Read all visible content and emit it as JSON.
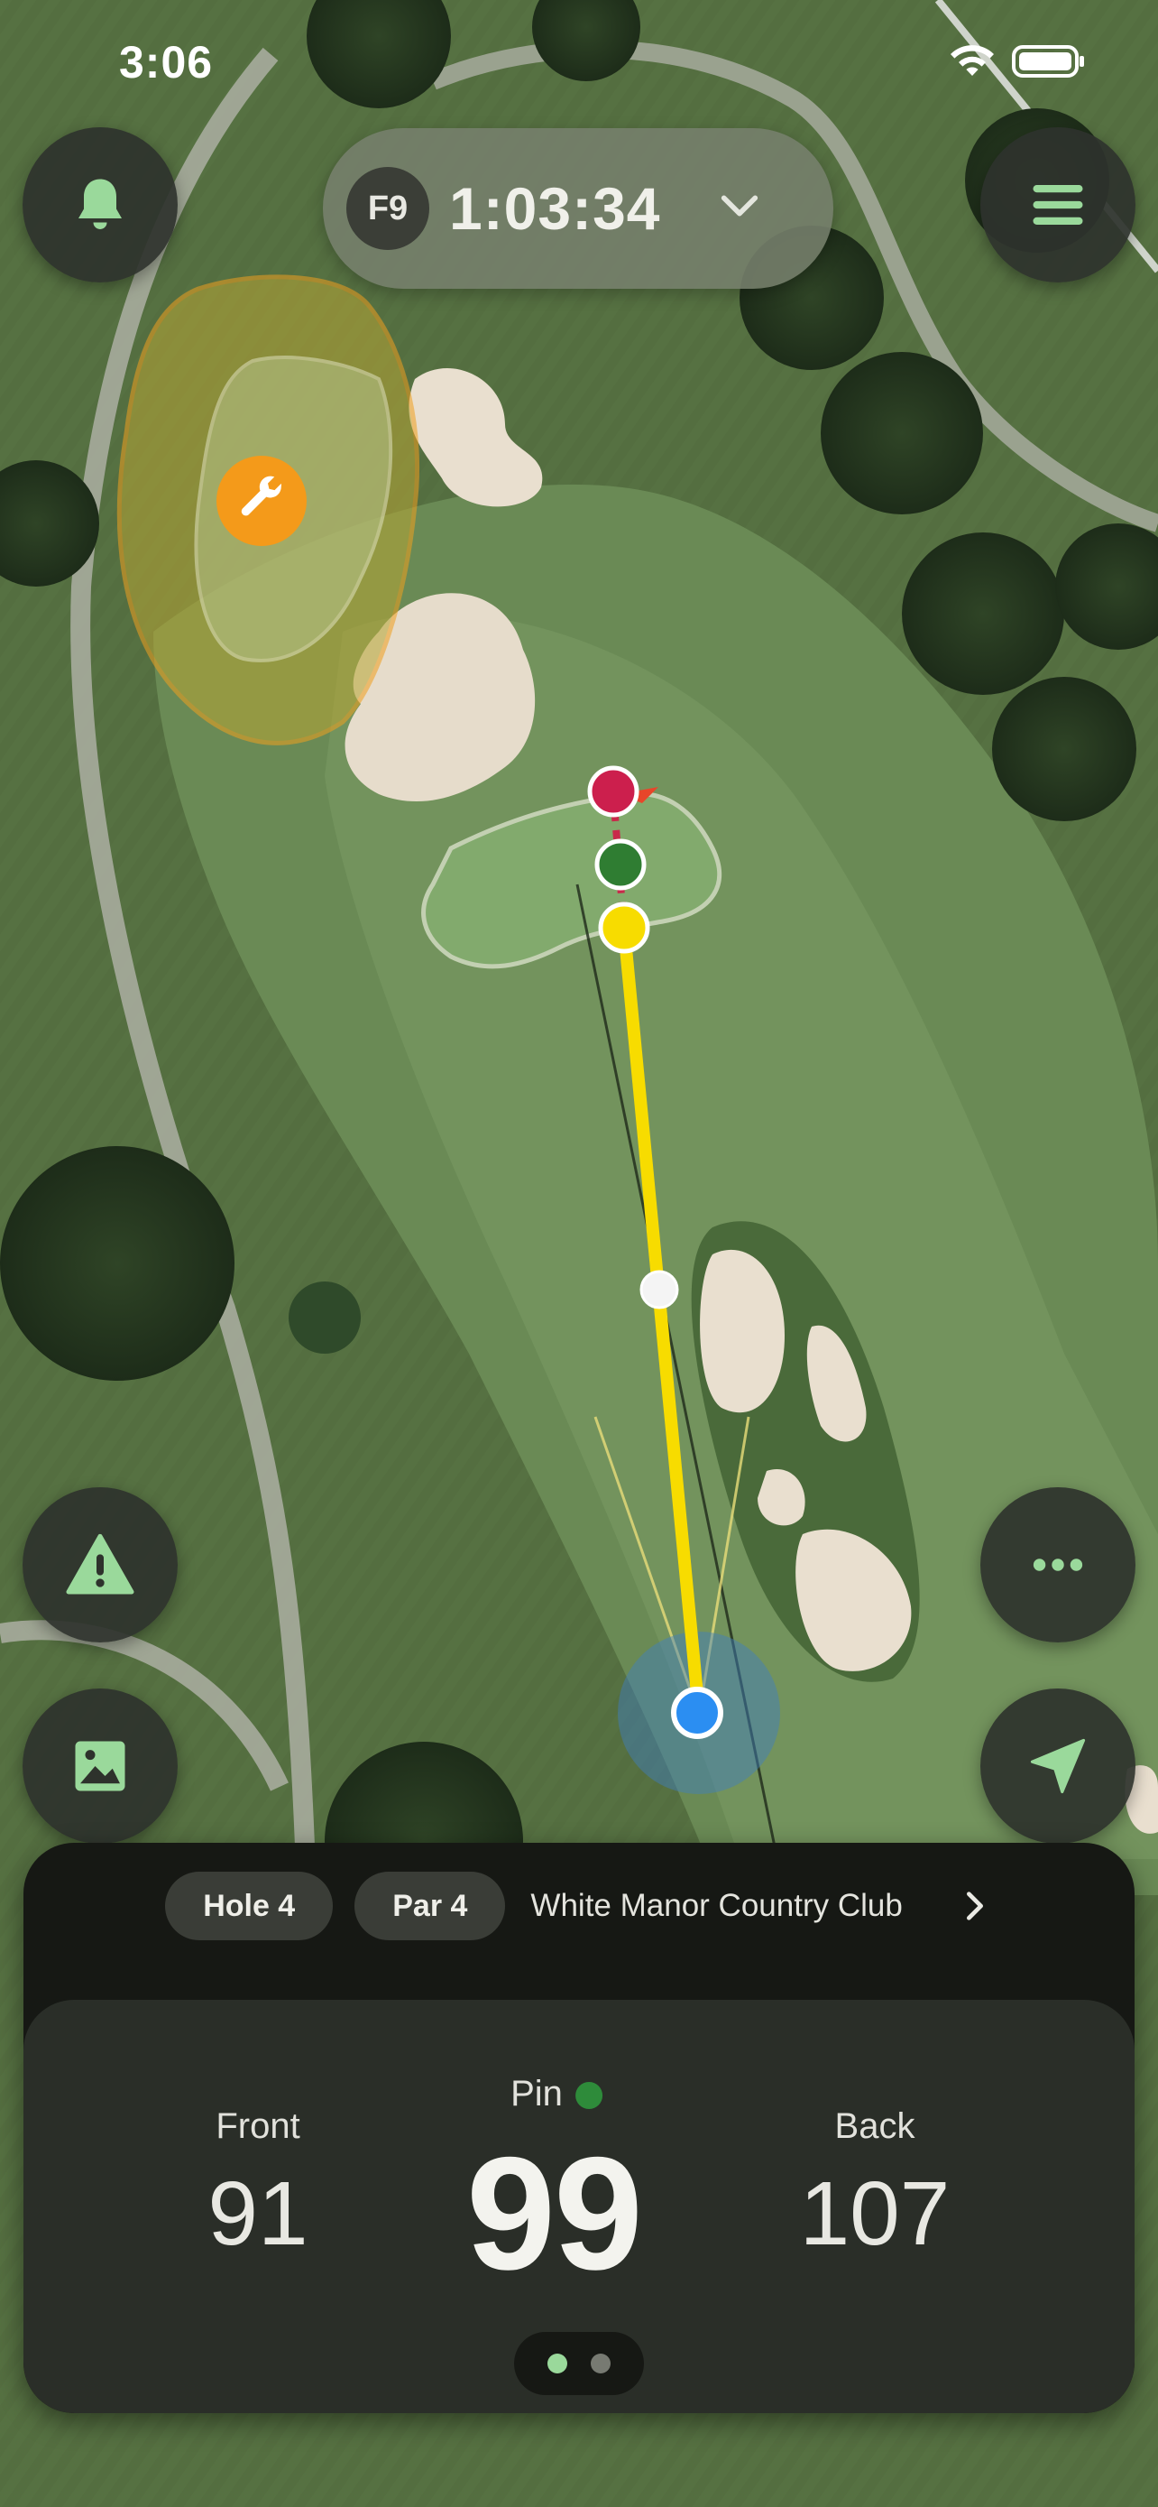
{
  "status_bar": {
    "time": "3:06"
  },
  "round": {
    "nine": "F9",
    "elapsed": "1:03:34"
  },
  "hole": {
    "hole_label": "Hole 4",
    "par_label": "Par 4",
    "course": "White Manor Country Club"
  },
  "distances": {
    "front_label": "Front",
    "front": "91",
    "pin_label": "Pin",
    "pin": "99",
    "back_label": "Back",
    "back": "107"
  },
  "pager": {
    "pages": 2,
    "active_index": 0
  },
  "icons": {
    "notifications": "bell-icon",
    "menu": "hamburger-menu-icon",
    "hazard": "warning-triangle-icon",
    "image": "image-icon",
    "more": "ellipsis-icon",
    "locate": "location-arrow-icon",
    "maintenance": "wrench-icon",
    "chevron_down": "chevron-down-icon",
    "chevron_right": "chevron-right-icon"
  },
  "colors": {
    "accent_green": "#9ad99b",
    "pin_red": "#cc1f4d",
    "green_marker": "#2f7d32",
    "target_yellow": "#f7dc00",
    "player_blue": "#2b8ef2",
    "maintenance_orange": "#f49a1a"
  }
}
